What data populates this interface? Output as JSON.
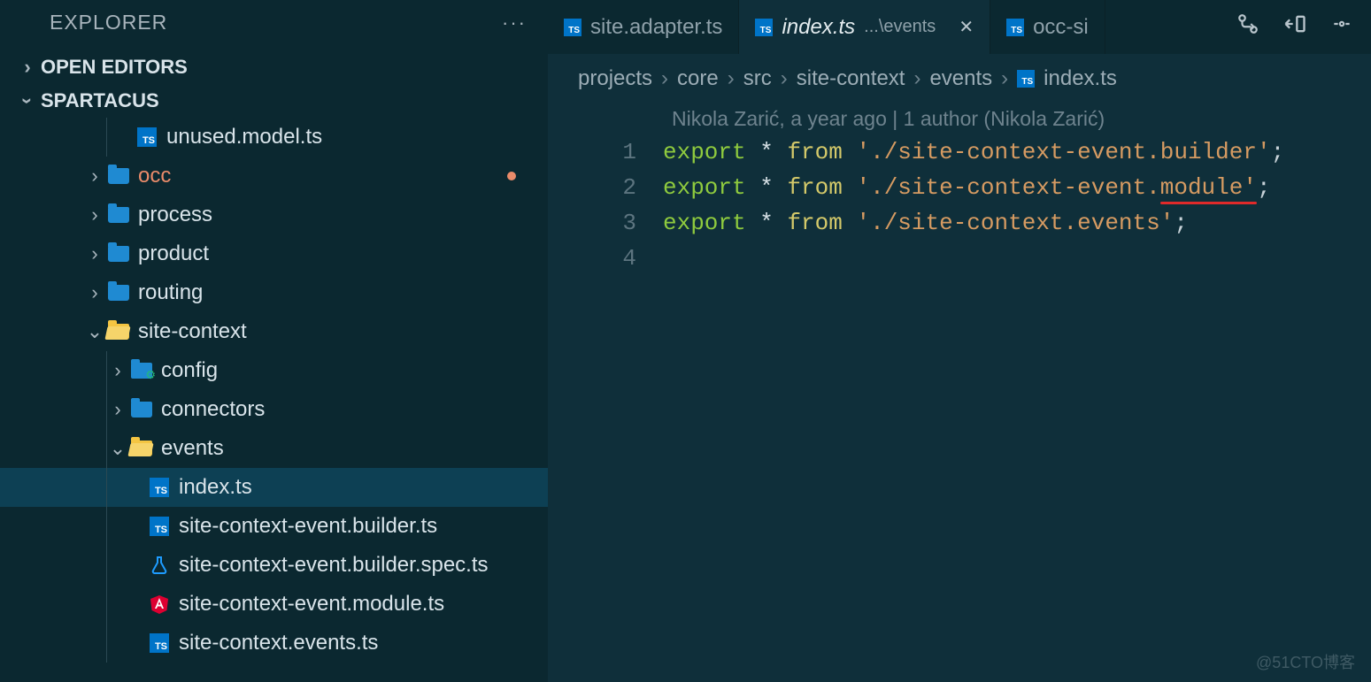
{
  "explorer": {
    "title": "EXPLORER",
    "sections": {
      "open_editors": "OPEN EDITORS",
      "workspace": "SPARTACUS"
    },
    "tree": [
      {
        "indent": 152,
        "kind": "ts",
        "label": "unused.model.ts"
      },
      {
        "indent": 100,
        "kind": "folder",
        "chev": "right",
        "label": "occ",
        "modified": true
      },
      {
        "indent": 100,
        "kind": "folder",
        "chev": "right",
        "label": "process"
      },
      {
        "indent": 100,
        "kind": "folder",
        "chev": "right",
        "label": "product"
      },
      {
        "indent": 100,
        "kind": "folder",
        "chev": "right",
        "label": "routing"
      },
      {
        "indent": 100,
        "kind": "folder-open",
        "chev": "down",
        "label": "site-context"
      },
      {
        "indent": 126,
        "kind": "folder-cfg",
        "chev": "right",
        "label": "config"
      },
      {
        "indent": 126,
        "kind": "folder",
        "chev": "right",
        "label": "connectors"
      },
      {
        "indent": 126,
        "kind": "folder-open",
        "chev": "down",
        "label": "events"
      },
      {
        "indent": 166,
        "kind": "ts",
        "label": "index.ts",
        "selected": true
      },
      {
        "indent": 166,
        "kind": "ts",
        "label": "site-context-event.builder.ts"
      },
      {
        "indent": 166,
        "kind": "spec",
        "label": "site-context-event.builder.spec.ts"
      },
      {
        "indent": 166,
        "kind": "angular",
        "label": "site-context-event.module.ts"
      },
      {
        "indent": 166,
        "kind": "ts",
        "label": "site-context.events.ts"
      }
    ]
  },
  "tabs": [
    {
      "label": "site.adapter.ts",
      "active": false
    },
    {
      "label": "index.ts",
      "subpath": "...\\events",
      "active": true,
      "closable": true,
      "italic": true
    },
    {
      "label": "occ-si",
      "active": false
    }
  ],
  "breadcrumb": [
    "projects",
    "core",
    "src",
    "site-context",
    "events",
    "index.ts"
  ],
  "codelens": "Nikola Zarić, a year ago | 1 author (Nikola Zarić)",
  "code": {
    "lines": [
      {
        "n": 1,
        "export": "export",
        "star": "*",
        "from": "from",
        "str": "'./site-context-event.builder'",
        "semi": ";"
      },
      {
        "n": 2,
        "export": "export",
        "star": "*",
        "from": "from",
        "str_prefix": "'./site-context-event.",
        "str_ul": "module'",
        "semi": ";"
      },
      {
        "n": 3,
        "export": "export",
        "star": "*",
        "from": "from",
        "str": "'./site-context.events'",
        "semi": ";"
      },
      {
        "n": 4
      }
    ]
  },
  "watermark": "@51CTO博客"
}
